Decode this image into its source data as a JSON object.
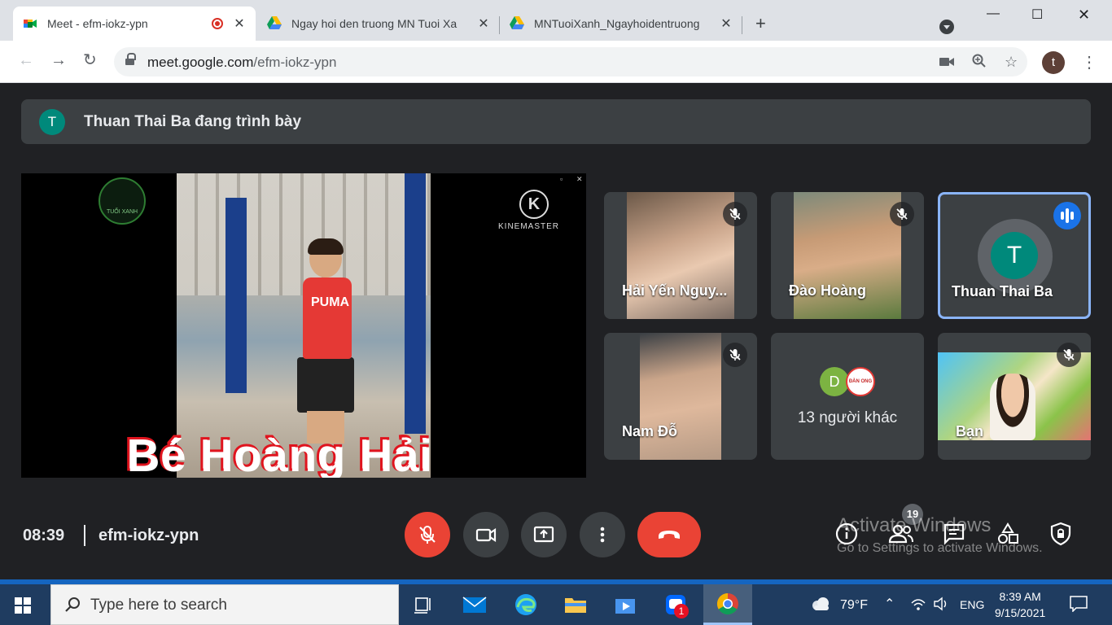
{
  "browser": {
    "tabs": [
      {
        "title": "Meet - efm-iokz-ypn",
        "recording": true
      },
      {
        "title": "Ngay hoi den truong MN Tuoi Xa"
      },
      {
        "title": "MNTuoiXanh_Ngayhoidentruong"
      }
    ],
    "url_host": "meet.google.com",
    "url_path": "/efm-iokz-ypn",
    "profile_initial": "t"
  },
  "meet": {
    "banner": {
      "avatar": "T",
      "text": "Thuan Thai Ba đang trình bày"
    },
    "presentation": {
      "caption": "Bé Hoàng Hải",
      "shirt_text": "PUMA",
      "watermark": "KINEMASTER",
      "logo_text": "TUỔI XANH"
    },
    "tiles": [
      {
        "name": "Hải Yến Nguy...",
        "muted": true
      },
      {
        "name": "Đào Hoàng",
        "muted": true
      },
      {
        "name": "Thuan Thai Ba",
        "avatar": "T",
        "speaking": true
      },
      {
        "name": "Nam Đỗ",
        "muted": true
      },
      {
        "name": "13 người khác",
        "avatar": "D",
        "logo_text": "ĐÀN ONG"
      },
      {
        "name": "Bạn",
        "muted": true
      }
    ],
    "bottom": {
      "time": "08:39",
      "meeting_code": "efm-iokz-ypn",
      "participants_count": "19"
    },
    "activate": {
      "title": "Activate Windows",
      "subtitle": "Go to Settings to activate Windows."
    }
  },
  "taskbar": {
    "search_placeholder": "Type here to search",
    "weather": "79°F",
    "language": "ENG",
    "time": "8:39 AM",
    "date": "9/15/2021",
    "zalo_badge": "1"
  }
}
